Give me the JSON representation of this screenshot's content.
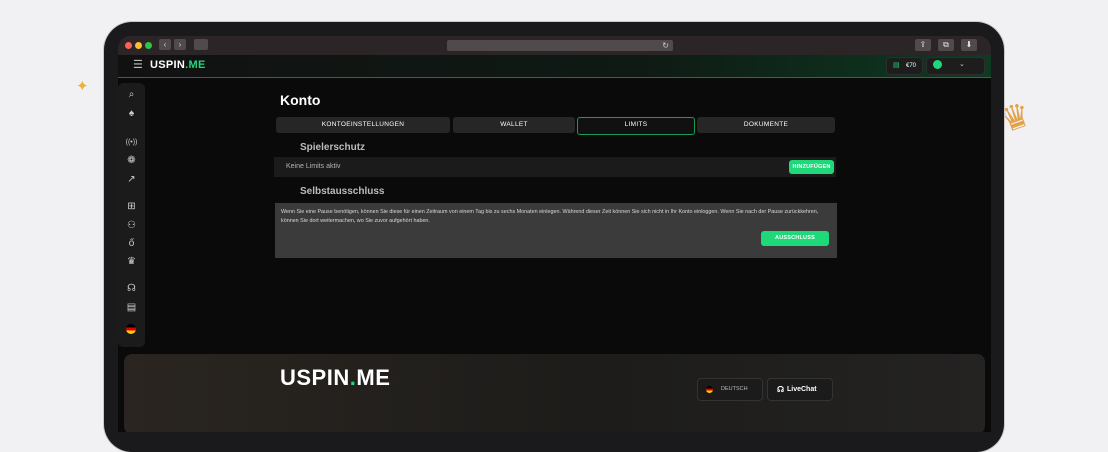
{
  "browser": {
    "back": "‹",
    "forward": "›",
    "reload": "↻"
  },
  "header": {
    "logo": {
      "main": "USPIN",
      "dot": ".",
      "suffix": "ME"
    },
    "hamburger": "☰",
    "balance": {
      "icon": "▤",
      "amount": "€70"
    },
    "user_chevron": "⌄"
  },
  "sidebar": {
    "icons": [
      "search-icon",
      "spade-icon",
      "live-icon",
      "slots-icon",
      "chart-icon",
      "gift-icon",
      "medal-icon",
      "money-bag-icon",
      "crown-icon",
      "headset-icon",
      "news-icon",
      "flag-icon"
    ]
  },
  "account": {
    "title": "Konto",
    "tabs": [
      {
        "label": "KONTOEINSTELLUNGEN"
      },
      {
        "label": "WALLET"
      },
      {
        "label": "LIMITS",
        "active": true
      },
      {
        "label": "DOKUMENTE"
      }
    ]
  },
  "player_protection": {
    "title": "Spielerschutz",
    "status_text": "Keine Limits aktiv",
    "add_label": "HINZUFÜGEN"
  },
  "self_exclusion": {
    "title": "Selbstausschluss",
    "text": "Wenn Sie eine Pause benötigen, können Sie diese für einen Zeitraum von einem Tag bis zu sechs Monaten einlegen. Während dieser Zeit können Sie sich nicht in Ihr Konto einloggen. Wenn Sie nach der Pause zurückkehren, können Sie dort weitermachen, wo Sie zuvor aufgehört haben.",
    "button_label": "AUSSCHLUSS"
  },
  "footer": {
    "logo": {
      "main": "USPIN",
      "dot": ".",
      "suffix": "ME"
    },
    "language": "DEUTSCH",
    "livechat": "LiveChat"
  },
  "colors": {
    "accent": "#1ed87a",
    "background": "#0a0a0a"
  }
}
